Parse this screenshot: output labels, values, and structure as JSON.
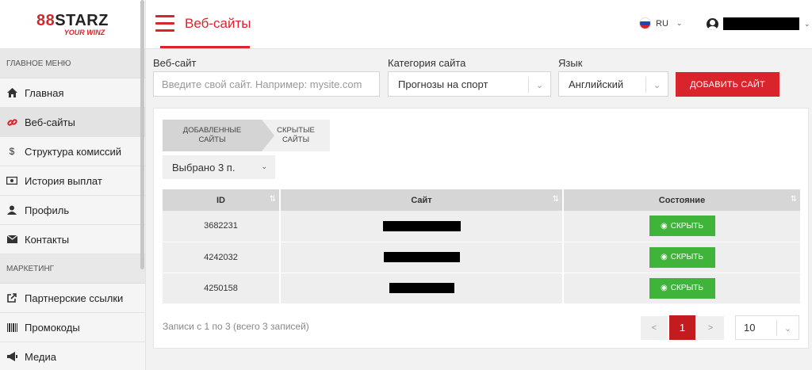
{
  "logo": {
    "brand_a": "8",
    "brand_b": "8",
    "brand_c": "STARZ",
    "slogan": "YOUR WINZ"
  },
  "sidebar": {
    "main_header": "ГЛАВНОЕ МЕНЮ",
    "items": [
      {
        "label": "Главная",
        "icon": "home-icon"
      },
      {
        "label": "Веб-сайты",
        "icon": "link-icon"
      },
      {
        "label": "Структура комиссий",
        "icon": "dollar-icon"
      },
      {
        "label": "История выплат",
        "icon": "money-icon"
      },
      {
        "label": "Профиль",
        "icon": "user-icon"
      },
      {
        "label": "Контакты",
        "icon": "envelope-icon"
      }
    ],
    "marketing_header": "МАРКЕТИНГ",
    "marketing_items": [
      {
        "label": "Партнерские ссылки",
        "icon": "external-link-icon"
      },
      {
        "label": "Промокоды",
        "icon": "barcode-icon"
      },
      {
        "label": "Медиа",
        "icon": "megaphone-icon"
      }
    ]
  },
  "header": {
    "title": "Веб-сайты",
    "language": "RU"
  },
  "filters": {
    "website_label": "Веб-сайт",
    "website_placeholder": "Введите свой сайт. Например: mysite.com",
    "category_label": "Категория сайта",
    "category_value": "Прогнозы на спорт",
    "language_label": "Язык",
    "language_value": "Английский",
    "add_button": "ДОБАВИТЬ САЙТ"
  },
  "tabs": {
    "added_line1": "ДОБАВЛЕННЫЕ",
    "added_line2": "САЙТЫ",
    "hidden_line1": "СКРЫТЫЕ",
    "hidden_line2": "САЙТЫ"
  },
  "selected_dropdown": "Выбрано 3 п.",
  "table": {
    "col_id": "ID",
    "col_site": "Сайт",
    "col_state": "Состояние",
    "rows": [
      {
        "id": "3682231",
        "action": "СКРЫТЬ"
      },
      {
        "id": "4242032",
        "action": "СКРЫТЬ"
      },
      {
        "id": "4250158",
        "action": "СКРЫТЬ"
      }
    ]
  },
  "summary": "Записи с 1 по 3 (всего 3 записей)",
  "pagination": {
    "prev": "<",
    "current": "1",
    "next": ">",
    "per_page": "10"
  },
  "colors": {
    "accent": "#d8242a",
    "success": "#3fb33a"
  }
}
